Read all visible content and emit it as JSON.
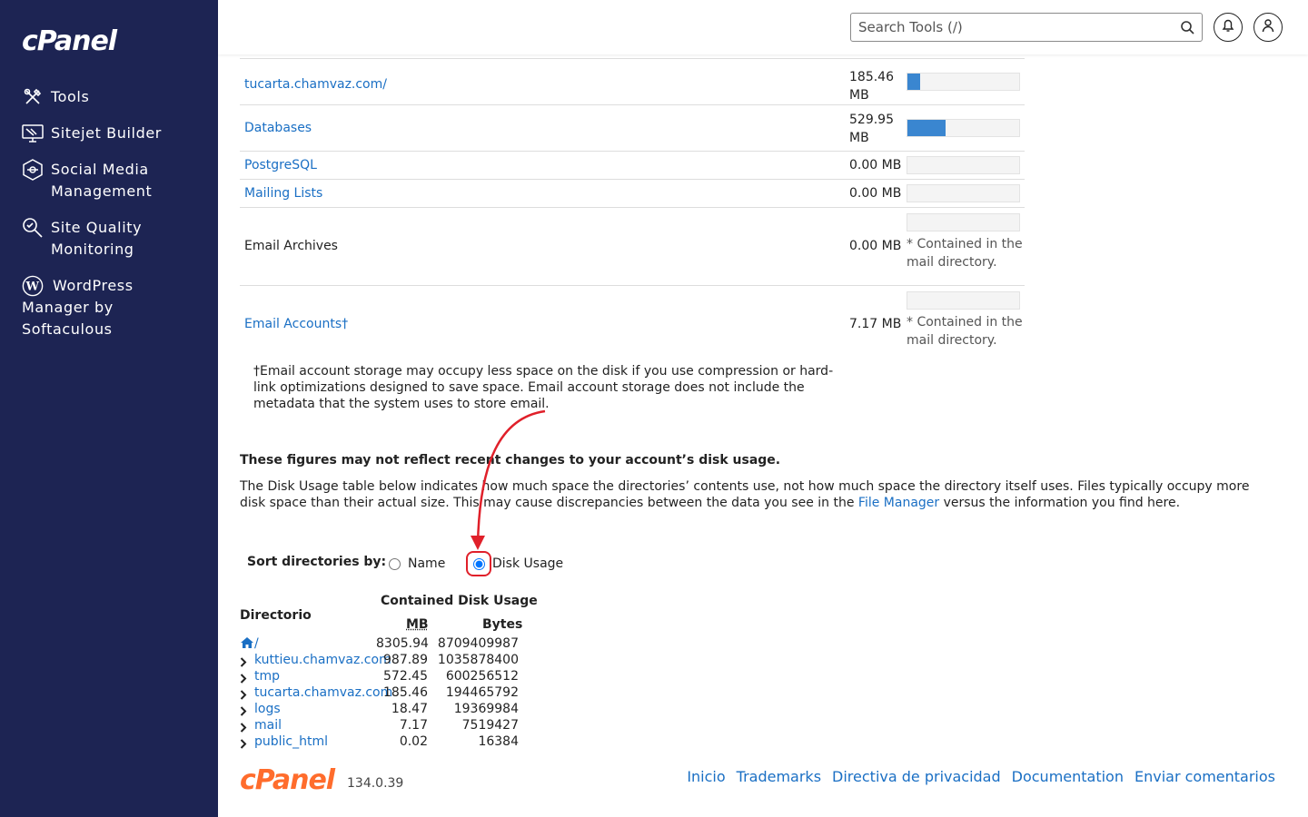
{
  "brand": {
    "logo_text": "cPanel",
    "version": "134.0.39"
  },
  "sidebar": {
    "items": [
      {
        "label": "Tools",
        "icon": "tools-icon"
      },
      {
        "label": "Sitejet Builder",
        "icon": "monitor-icon"
      },
      {
        "label": "Social Media Management",
        "icon": "social-icon"
      },
      {
        "label": "Site Quality Monitoring",
        "icon": "magnifier-icon"
      },
      {
        "label": "WordPress Manager by Softaculous",
        "icon": "wordpress-icon"
      }
    ]
  },
  "topbar": {
    "search_placeholder": "Search Tools (/)"
  },
  "usage_rows": [
    {
      "name": "tucarta.chamvaz.com/",
      "size": "185.46 MB",
      "bar_fraction": 0.11,
      "link": true
    },
    {
      "name": "Databases",
      "size": "529.95 MB",
      "bar_fraction": 0.34,
      "link": true
    },
    {
      "name": "PostgreSQL",
      "size": "0.00 MB",
      "bar_fraction": 0,
      "link": true
    },
    {
      "name": "Mailing Lists",
      "size": "0.00 MB",
      "bar_fraction": 0,
      "link": true
    },
    {
      "name": "Email Archives",
      "size": "0.00 MB",
      "bar_fraction": 0,
      "link": false,
      "note": "* Contained in the mail directory."
    },
    {
      "name": "Email Accounts†",
      "size": "7.17 MB",
      "bar_fraction": 0,
      "link": true,
      "note": "* Contained in the mail directory."
    }
  ],
  "footnote": "†Email account storage may occupy less space on the disk if you use compression or hard-link optimizations designed to save space. Email account storage does not include the metadata that the system uses to store email.",
  "warning": {
    "title": "These figures may not reflect recent changes to your account’s disk usage.",
    "text_before": "The Disk Usage table below indicates how much space the directories’ contents use, not how much space the directory itself uses. Files typically occupy more disk space than their actual size. This may cause discrepancies between the data you see in the ",
    "link": "File Manager",
    "text_after": " versus the information you find here."
  },
  "sort": {
    "label": "Sort directories by:",
    "options": [
      {
        "label": "Name",
        "checked": false
      },
      {
        "label": "Disk Usage",
        "checked": true
      }
    ]
  },
  "dir_table": {
    "header_dir": "Directorio",
    "header_contained": "Contained Disk Usage",
    "header_mb": "MB",
    "header_bytes": "Bytes",
    "rows": [
      {
        "name": "/",
        "mb": "8305.94",
        "bytes": "8709409987",
        "root": true
      },
      {
        "name": "kuttieu.chamvaz.com",
        "mb": "987.89",
        "bytes": "1035878400"
      },
      {
        "name": "tmp",
        "mb": "572.45",
        "bytes": "600256512"
      },
      {
        "name": "tucarta.chamvaz.com",
        "mb": "185.46",
        "bytes": "194465792"
      },
      {
        "name": "logs",
        "mb": "18.47",
        "bytes": "19369984"
      },
      {
        "name": "mail",
        "mb": "7.17",
        "bytes": "7519427"
      },
      {
        "name": "public_html",
        "mb": "0.02",
        "bytes": "16384"
      }
    ]
  },
  "footer": {
    "links": [
      "Inicio",
      "Trademarks",
      "Directiva de privacidad",
      "Documentation",
      "Enviar comentarios"
    ]
  },
  "colors": {
    "sidebar_bg": "#1d2453",
    "link": "#1a6fc4",
    "bar_fill": "#3a86d0",
    "annotation": "#e0202a",
    "footer_logo": "#ff6c2c"
  }
}
